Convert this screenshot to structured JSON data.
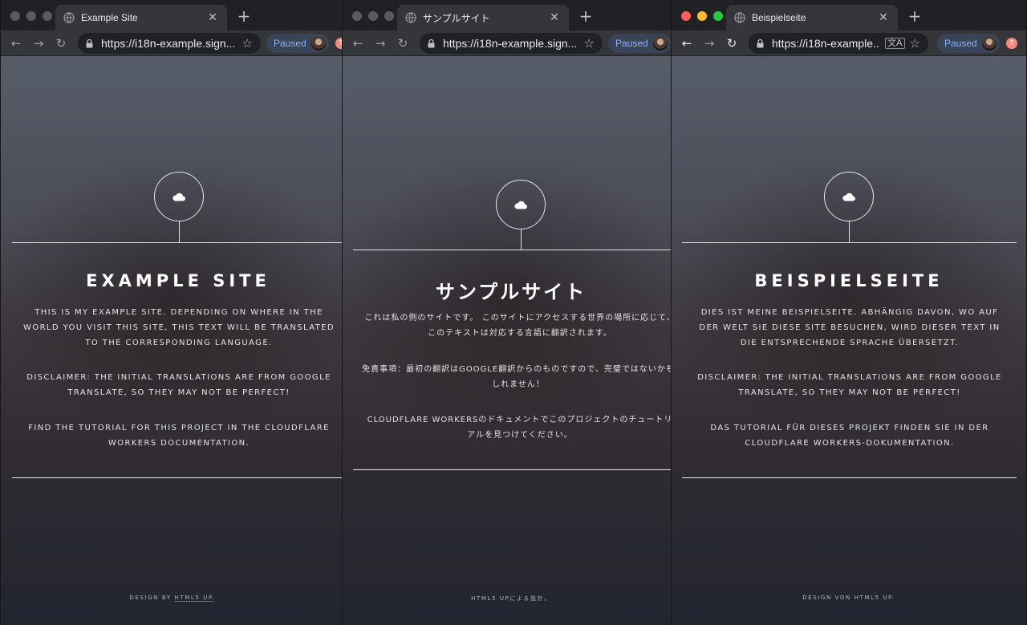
{
  "windows": [
    {
      "tab_title": "Example Site",
      "url": "https://i18n-example.sign...",
      "paused_label": "Paused",
      "heading": "EXAMPLE SITE",
      "paragraphs": [
        "THIS IS MY EXAMPLE SITE. DEPENDING ON WHERE IN THE WORLD YOU VISIT THIS SITE, THIS TEXT WILL BE TRANSLATED TO THE CORRESPONDING LANGUAGE.",
        "DISCLAIMER: THE INITIAL TRANSLATIONS ARE FROM GOOGLE TRANSLATE, SO THEY MAY NOT BE PERFECT!",
        "FIND THE TUTORIAL FOR THIS PROJECT IN THE CLOUDFLARE WORKERS DOCUMENTATION."
      ],
      "footer_prefix": "DESIGN BY ",
      "footer_link": "HTML5 UP",
      "footer_suffix": "."
    },
    {
      "tab_title": "サンプルサイト",
      "url": "https://i18n-example.sign...",
      "paused_label": "Paused",
      "heading": "サンプルサイト",
      "paragraphs": [
        "これは私の例のサイトです。 このサイトにアクセスする世界の場所に応じて、このテキストは対応する言語に翻訳されます。",
        "免責事項：最初の翻訳はGOOGLE翻訳からのものですので、完璧ではないかもしれません！",
        "CLOUDFLARE WORKERSのドキュメントでこのプロジェクトのチュートリアルを見つけてください。"
      ],
      "footer_text": "HTML5 UPによる設計。"
    },
    {
      "tab_title": "Beispielseite",
      "url": "https://i18n-example...",
      "paused_label": "Paused",
      "heading": "BEISPIELSEITE",
      "paragraphs": [
        "DIES IST MEINE BEISPIELSEITE. ABHÄNGIG DAVON, WO AUF DER WELT SIE DIESE SITE BESUCHEN, WIRD DIESER TEXT IN DIE ENTSPRECHENDE SPRACHE ÜBERSETZT.",
        "DISCLAIMER: THE INITIAL TRANSLATIONS ARE FROM GOOGLE TRANSLATE, SO THEY MAY NOT BE PERFECT!",
        "DAS TUTORIAL FÜR DIESES PROJEKT FINDEN SIE IN DER CLOUDFLARE WORKERS-DOKUMENTATION."
      ],
      "footer_text": "DESIGN VON HTML5 UP."
    }
  ],
  "icons": {
    "back": "arrow-left-icon",
    "forward": "arrow-right-icon",
    "reload": "reload-icon",
    "lock": "lock-icon",
    "star": "star-icon",
    "translate": "translate-icon",
    "logo": "cloud-icon",
    "tab": "globe-icon",
    "update": "update-icon"
  },
  "colors": {
    "tabbar": "#202124",
    "toolbar": "#35363a",
    "paused_text": "#8ab4f8",
    "paused_bg": "#394457",
    "close_dot": "#ff5f57",
    "minimize_dot": "#febc2e",
    "zoom_dot": "#28c840"
  }
}
